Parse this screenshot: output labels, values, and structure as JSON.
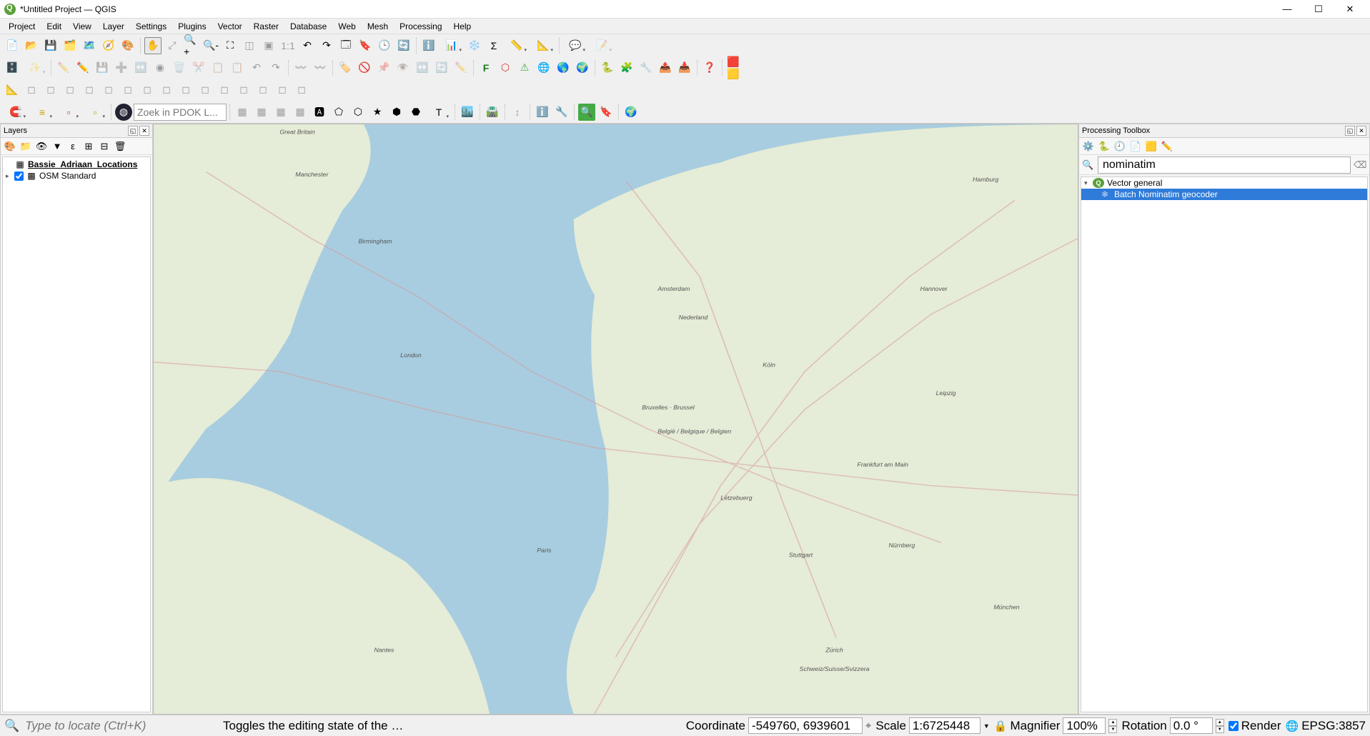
{
  "window": {
    "title": "*Untitled Project — QGIS"
  },
  "menus": [
    "Project",
    "Edit",
    "View",
    "Layer",
    "Settings",
    "Plugins",
    "Vector",
    "Raster",
    "Database",
    "Web",
    "Mesh",
    "Processing",
    "Help"
  ],
  "pdok_placeholder": "Zoek in PDOK L...",
  "panels": {
    "layers": {
      "title": "Layers",
      "items": [
        {
          "name": "Bassie_Adriaan_Locations",
          "checked": false,
          "icon": "table",
          "bold": true
        },
        {
          "name": "OSM Standard",
          "checked": true,
          "icon": "raster",
          "bold": false
        }
      ]
    },
    "processing": {
      "title": "Processing Toolbox",
      "search_value": "nominatim",
      "group": "Vector general",
      "selected_alg": "Batch Nominatim geocoder"
    }
  },
  "status": {
    "locate_placeholder": "Type to locate (Ctrl+K)",
    "message": "Toggles the editing state of the curre",
    "coord_label": "Coordinate",
    "coord_value": "-549760, 6939601",
    "scale_label": "Scale",
    "scale_value": "1:6725448",
    "mag_label": "Magnifier",
    "mag_value": "100%",
    "rot_label": "Rotation",
    "rot_value": "0.0 °",
    "render_label": "Render",
    "render_checked": true,
    "crs_value": "EPSG:3857"
  }
}
